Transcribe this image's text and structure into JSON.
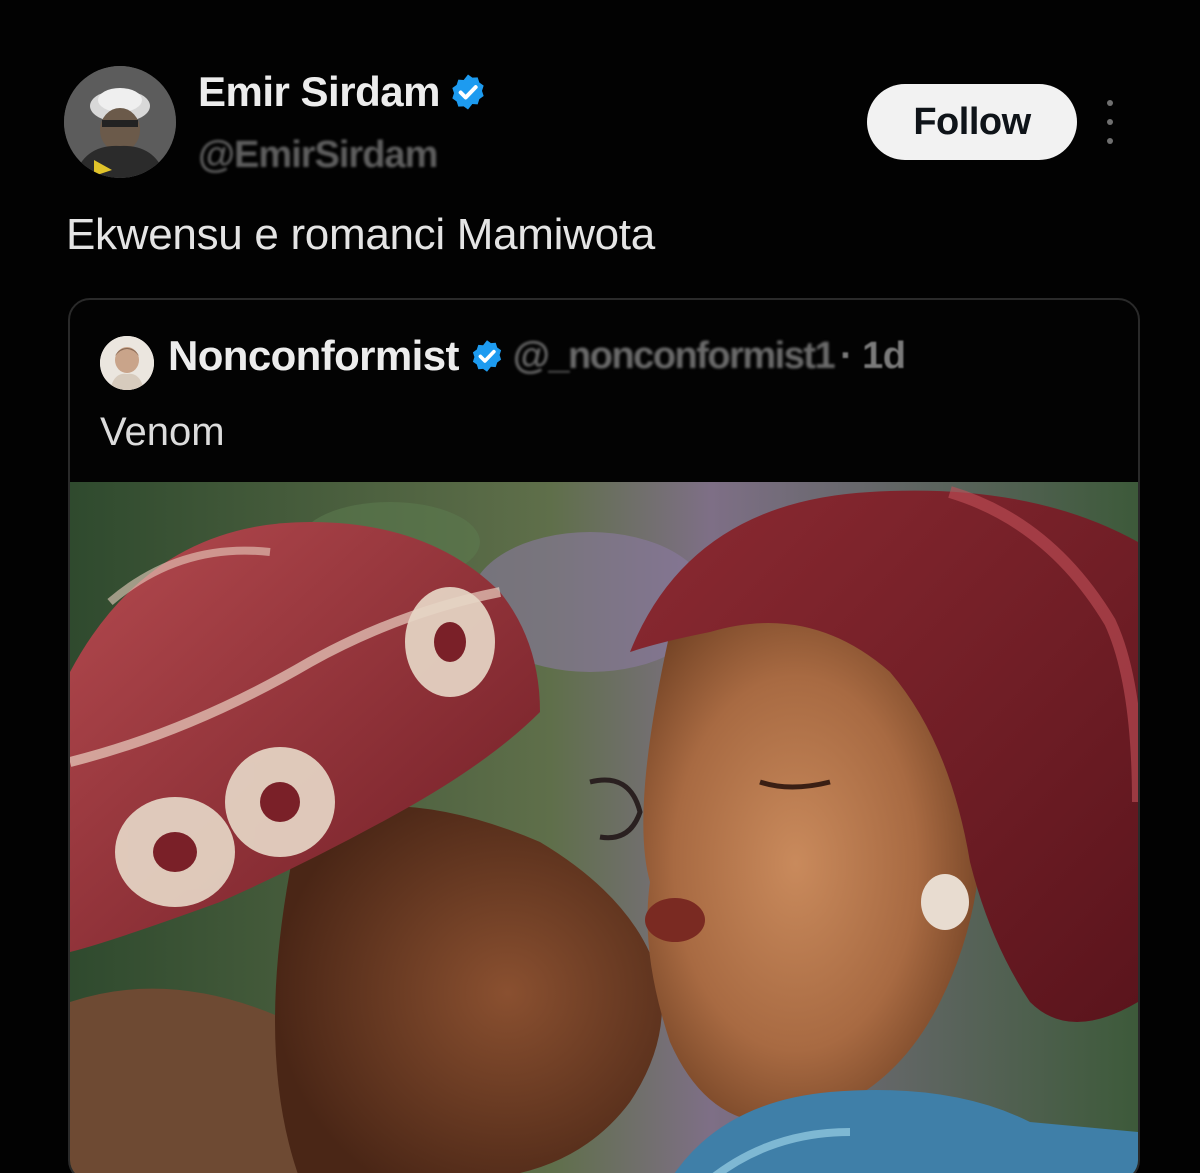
{
  "post": {
    "author": {
      "display_name": "Emir Sirdam",
      "handle": "@EmirSirdam",
      "verified": true,
      "avatar_icon": "profile-photo"
    },
    "follow_label": "Follow",
    "more_icon": "more-vertical-icon",
    "text": "Ekwensu e romanci Mamiwota"
  },
  "quote": {
    "author": {
      "display_name": "Nonconformist",
      "handle": "@_nonconformist1",
      "verified": true,
      "time": "· 1d"
    },
    "text": "Venom",
    "media": {
      "description_icon": "photo"
    }
  },
  "colors": {
    "background": "#020202",
    "verified_blue": "#1d9bf0",
    "follow_bg": "#f2f2f2"
  }
}
